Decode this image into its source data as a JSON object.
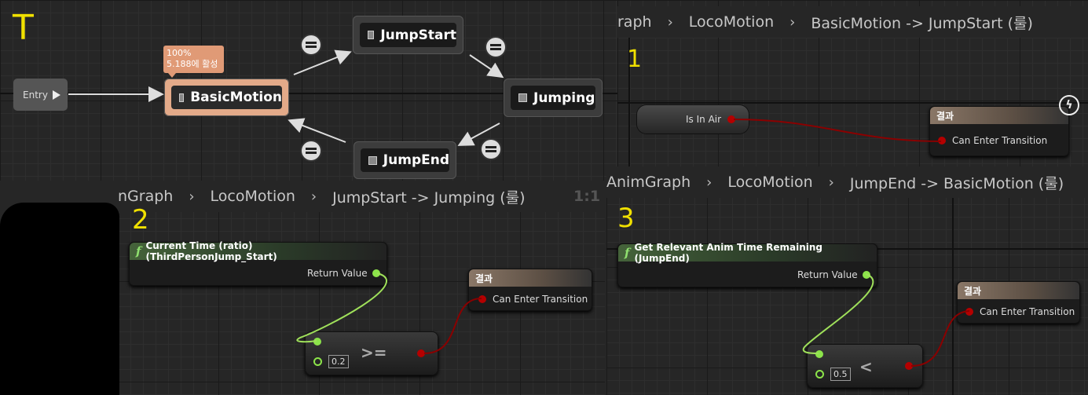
{
  "graph_top": {
    "entry_label": "Entry",
    "tooltip_line1": "100%",
    "tooltip_line2": "5.188에 활성",
    "states": {
      "basic": "BasicMotion",
      "jumpstart": "JumpStart",
      "jumping": "Jumping",
      "jumpend": "JumpEnd"
    },
    "annotation": "T"
  },
  "panel1": {
    "crumbs": [
      "raph",
      "LocoMotion",
      "BasicMotion -> JumpStart (룰)"
    ],
    "annotation": "1",
    "input_node": "Is In Air",
    "result_title": "결과",
    "result_pin": "Can Enter Transition"
  },
  "panel2": {
    "crumbs": [
      "nGraph",
      "LocoMotion",
      "JumpStart -> Jumping (룰)"
    ],
    "zoom": "1:1",
    "annotation": "2",
    "func_title": "Current Time (ratio) (ThirdPersonJump_Start)",
    "return_label": "Return Value",
    "compare_value": "0.2",
    "operator": ">=",
    "result_title": "결과",
    "result_pin": "Can Enter Transition"
  },
  "panel3": {
    "crumbs": [
      "AnimGraph",
      "LocoMotion",
      "JumpEnd -> BasicMotion (룰)"
    ],
    "annotation": "3",
    "func_title": "Get Relevant Anim Time Remaining (JumpEnd)",
    "return_label": "Return Value",
    "compare_value": "0.5",
    "operator": "<",
    "result_title": "결과",
    "result_pin": "Can Enter Transition"
  },
  "colors": {
    "active_state": "#e3aa89",
    "bool_pin": "#b40000",
    "float_pin": "#8ce44a"
  }
}
